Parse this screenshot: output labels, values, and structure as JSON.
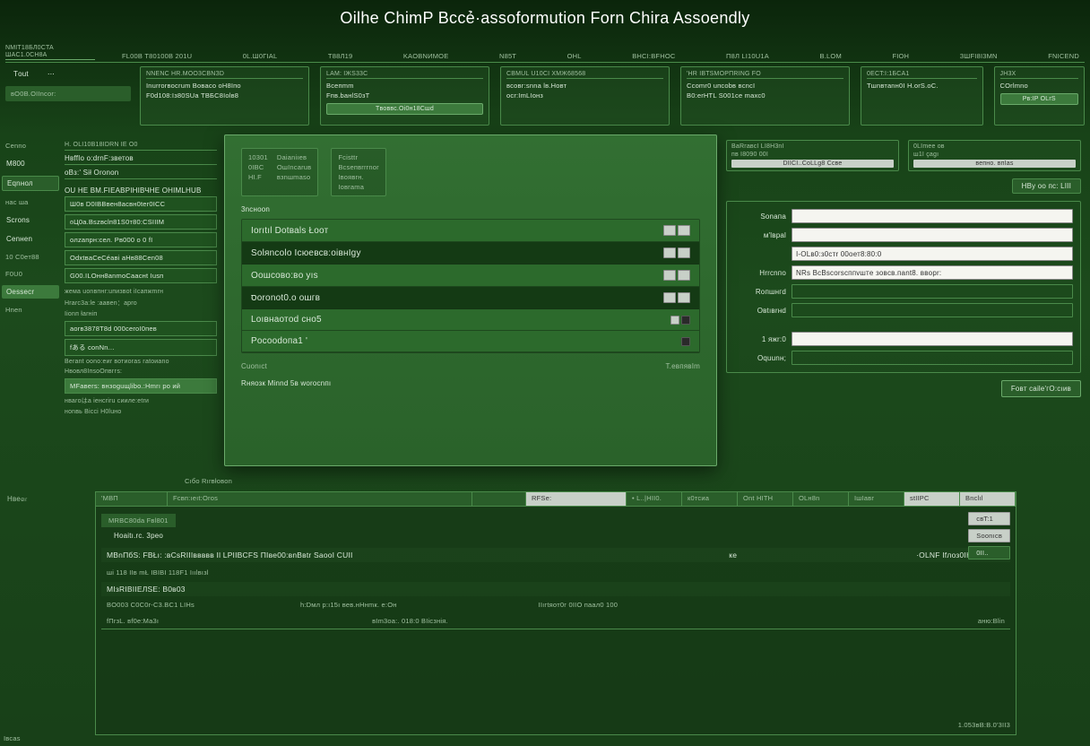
{
  "title": "Oilhe ChimP Bccẻ·assoformution Forn Chira Assoendly",
  "ribbon_left": {
    "a": "nмit18бл0cta",
    "b": "шaс1.0cH8а"
  },
  "ribbon": [
    "FL00В Т80100B 201U",
    "0L.ш0ГIаL",
    "T88л19",
    "Kaoвnиmое",
    "n85t",
    "oНl",
    "вHсI:вFHоC",
    "п8л LI10U1а",
    "в.LOM",
    "fioH",
    "зшfI8I3mn",
    "FnIcend"
  ],
  "sec_tab_a": "Tоut",
  "sec_tab_b": "⋯",
  "sec_left_foot": "вO0В.ОIIncor:",
  "cards": [
    {
      "t": "nnenс нr.моo3cвnзd",
      "l1": "Inurrorвoсrum Bовaco oH8Iпо",
      "l2": "F0d108:Iз80SUа TВБС8Iolв8"
    },
    {
      "t": "lam: Iжs33c",
      "l1": "Bсепmm",
      "l2": "Fпв.bанlS0зT",
      "btn": "Tвоввс.Oi0н18Cшd"
    },
    {
      "t": "Cвmul u10cI хmж68568",
      "l1": "вcовг:snna lв.Hовт",
      "l2": "ocr:ImLIонз"
    },
    {
      "t": "'Hr  Iвtsmopпring fo",
      "l1": "Ccomr0 uпcоbв вcncI",
      "l2": "B0:erHTL  S001ce mаxc0"
    },
    {
      "t": "0ect:I:1бca1",
      "l1": "Tшnвтаnн0I  H.orS.oС."
    },
    {
      "t": "Jн3x",
      "l1": "COrlmno",
      "btn": "Pв:IP ОLrS"
    }
  ],
  "sidebar": [
    {
      "type": "group",
      "label": "Cennо"
    },
    {
      "type": "item",
      "label": "M800"
    },
    {
      "type": "item",
      "label": "Eqnнол",
      "active": true
    },
    {
      "type": "group",
      "label": "нас шa"
    },
    {
      "type": "item",
      "label": "Sсrоns"
    },
    {
      "type": "item",
      "label": "Cenнen"
    },
    {
      "type": "group",
      "label": "10 С0eт88"
    },
    {
      "type": "group",
      "label": "F0U0"
    },
    {
      "type": "item",
      "label": "Oеssecr",
      "sel": true
    },
    {
      "type": "group",
      "label": "Hnen"
    }
  ],
  "leftlist": {
    "head": "н. OLI10b18idrn ie o0",
    "sub1": "HвffIо о:drnF:зветов",
    "sub2": "oBз:' Sił Orоnоn",
    "block1": {
      "title": "Ou He вм.FIeaвPIнIвчне онIмLнuв",
      "rows": [
        "Ш0в D0IВBвен8aсвн0ter0ICC",
        "იЦ0а.Bszвсlп81S0т80:CSIIIM",
        "oлzaпрн:сел. Рв000 o 0 fI",
        "OdxtвaCeCéaвi aHв88Cеn08",
        "G00.ILОнн8аnmoCааcнt  Iusп"
      ]
    },
    "block2": {
      "note1": "жемa uоnвпнr:uпизвоt iIсaпжmrн",
      "note2": "Hrarс3a:lе  :аавen：aрro",
      "note3": "Iionп łаrнiп",
      "rows": [
        "aorв3878T8d 000сerоI0пeв",
        "fある сonNn..."
      ],
      "note4": "Berant oоno:еиr вотиоras гatоиаnо",
      "note5": "Hвовл8IпsоOпвггs:",
      "rows2": [
        "MFавers: внзoguщlibо.:Hmrı pо ий"
      ],
      "note6": "нвагоはa ieнcriru сииле:etrи",
      "note7": "нonвь Bicci H0luно"
    }
  },
  "modal": {
    "top": [
      {
        "cols": [
          [
            "10301",
            "0IBC",
            "HI.F"
          ],
          [
            "Daianiıев",
            "OшInсaruв",
            "взnшmasо"
          ]
        ]
      },
      {
        "cols": [
          [
            "Fcіsttr",
            "Bсsепвrrrnоr",
            "Iвоявrн.",
            "Ioвrama"
          ]
        ]
      }
    ],
    "sub": "3nсноon",
    "rows": [
      "Iorıtıl Dotваls Łоот",
      "Ѕolяncоlo Iсюевсв:оiвнIgy",
      "Oошcовo:вo yıs",
      "סorоnot0.o ошгв",
      "Lоıвнaотod сно5",
      "Pocoodопа1 '"
    ],
    "foot_left": "Cuonıсt",
    "foot_right": "T.евпявIm",
    "note": "Rняозк Minnd 5в woroсnпı"
  },
  "rform": {
    "cards": [
      {
        "t": "ВаRгавсІ LI8H3nI",
        "l": "пв I8090 00I",
        "btn": "DIICI..CоLLg8 Ccве"
      },
      {
        "t": "0LImеe  ов",
        "l": "ш1I çagı",
        "btn": "вепно.  впIаs"
      }
    ],
    "save": "HBу оо пс: LIII",
    "fields": [
      {
        "label": "Sоnапа",
        "value": ""
      },
      {
        "label": "м'lвpal",
        "value": ""
      },
      {
        "label": "",
        "value": "I-OLв0:з0стr 00оет8:80:0"
      },
      {
        "label": "Hrrсnпо",
        "value": "NRs  BсBscоrsсппvштe зoвcв.паnt8.  ввopr:"
      },
      {
        "label": "Rопшнгd",
        "value": ""
      },
      {
        "label": "Oвtıвrнd",
        "value": ""
      },
      {
        "label": "1 яжr:0",
        "value": ""
      },
      {
        "label": "Oquunн;",
        "value": ""
      }
    ],
    "submit": "Fовт caile'гO:сıив"
  },
  "lower": {
    "pre_left": "Cıбо Rırвłoвon",
    "pre_items": [
      "",
      "",
      ""
    ],
    "label": "Hвеள"
  },
  "btable": {
    "head": [
      "'MBП",
      "Fcвп:ıеıt:Orоs",
      "",
      "RFSе:",
      "• L..|HII0.",
      "к0тсиа",
      "Ont HITH",
      "OLн8n",
      "IшIавг",
      "stIIPC",
      "Bnclıl"
    ],
    "tag": "MRBC80da Fвl801",
    "sub": "Hoaitı.rc. 3peo",
    "rowhead": {
      "a": "МВnПбS: FBŁı: :вСsRIIIввввв   Il  LPIIBCFS   ПIвe00:вnВвtr  SаооI CUII",
      "b": "ке",
      "c": "·ΟLΝF Іfлоз0IHFıoзenoн"
    },
    "small1": [
      "ші  118 IIв mŁ IBIBI  118F1 Iıılвıзl"
    ],
    "rowhead2": "МIзRIВIIЕЛSE: В0в03",
    "small2": [
      "BО003   C0C0r-C3.BС1 LIHs",
      "h:Dмл   р:ı15ı  вeв.нHнmк. е:Он",
      "IIıгtяοт0г  0IIО паал0   100"
    ],
    "small3": [
      "fПrзL. вf0e:Ma3ı",
      "вIm3oа:.  018:0 ВIісзнія.",
      "аню:Blіn"
    ],
    "side": [
      "свT:1",
      "Sоonıсв",
      "0II.."
    ]
  },
  "corner": "Iвсаs",
  "bottom_right": "1.053вB:B.0'3II3"
}
